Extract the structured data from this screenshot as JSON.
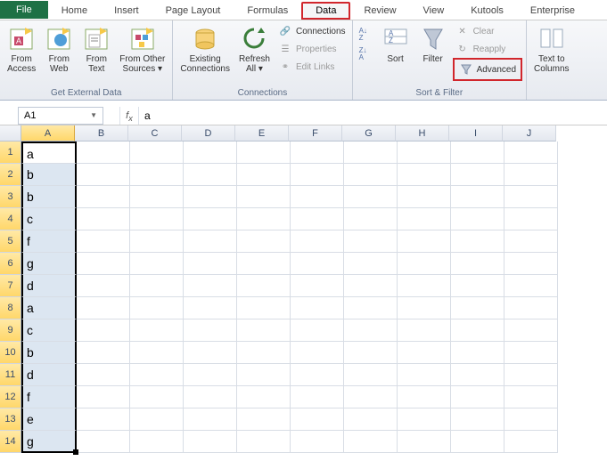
{
  "tabs": {
    "file": "File",
    "home": "Home",
    "insert": "Insert",
    "pagelayout": "Page Layout",
    "formulas": "Formulas",
    "data": "Data",
    "review": "Review",
    "view": "View",
    "kutools": "Kutools",
    "enterprise": "Enterprise"
  },
  "ribbon": {
    "getdata": {
      "label": "Get External Data",
      "access": "From\nAccess",
      "web": "From\nWeb",
      "text": "From\nText",
      "other": "From Other\nSources ▾"
    },
    "conns": {
      "label": "Connections",
      "existing": "Existing\nConnections",
      "refresh": "Refresh\nAll ▾",
      "connections": "Connections",
      "properties": "Properties",
      "editlinks": "Edit Links"
    },
    "sortfilter": {
      "label": "Sort & Filter",
      "sort": "Sort",
      "filter": "Filter",
      "clear": "Clear",
      "reapply": "Reapply",
      "advanced": "Advanced"
    },
    "datatools": {
      "texttocol": "Text to\nColumns"
    }
  },
  "namebox": "A1",
  "formulabar": "a",
  "columns": [
    "A",
    "B",
    "C",
    "D",
    "E",
    "F",
    "G",
    "H",
    "I",
    "J"
  ],
  "rows": [
    {
      "n": 1,
      "v": "a"
    },
    {
      "n": 2,
      "v": "b"
    },
    {
      "n": 3,
      "v": "b"
    },
    {
      "n": 4,
      "v": "c"
    },
    {
      "n": 5,
      "v": "f"
    },
    {
      "n": 6,
      "v": "g"
    },
    {
      "n": 7,
      "v": "d"
    },
    {
      "n": 8,
      "v": "a"
    },
    {
      "n": 9,
      "v": "c"
    },
    {
      "n": 10,
      "v": "b"
    },
    {
      "n": 11,
      "v": "d"
    },
    {
      "n": 12,
      "v": "f"
    },
    {
      "n": 13,
      "v": "e"
    },
    {
      "n": 14,
      "v": "g"
    }
  ]
}
